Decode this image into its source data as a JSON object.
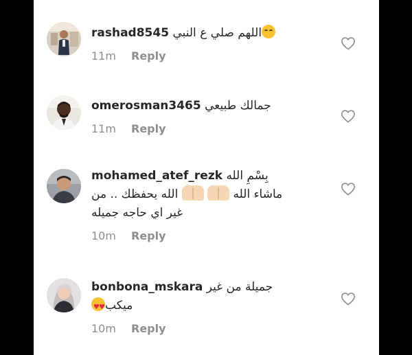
{
  "comments": [
    {
      "username": "rashad8545",
      "text_lines": [
        "اللهم صلي ع النبي"
      ],
      "time": "11m",
      "reply_label": "Reply",
      "emoji": "kissing-face"
    },
    {
      "username": "omerosman3465",
      "text_lines": [
        "جمالك طبيعي"
      ],
      "time": "11m",
      "reply_label": "Reply"
    },
    {
      "username": "mohamed_atef_rezk",
      "text_lines": [
        "بِسْمِ الله",
        "ماشاء الله",
        "الله يحفظك .. من",
        "غير اي حاجه جميله"
      ],
      "time": "10m",
      "reply_label": "Reply",
      "emoji": "raising-hands"
    },
    {
      "username": "bonbona_mskara",
      "text_lines": [
        "جميلة من غير",
        "ميكب"
      ],
      "time": "10m",
      "reply_label": "Reply",
      "emoji": "heart-eyes-face"
    }
  ],
  "colors": {
    "text": "#262626",
    "secondary": "#8e8e8e",
    "background": "#ffffff",
    "letterbox": "#000000"
  },
  "icons": {
    "like": "heart-outline-icon"
  }
}
